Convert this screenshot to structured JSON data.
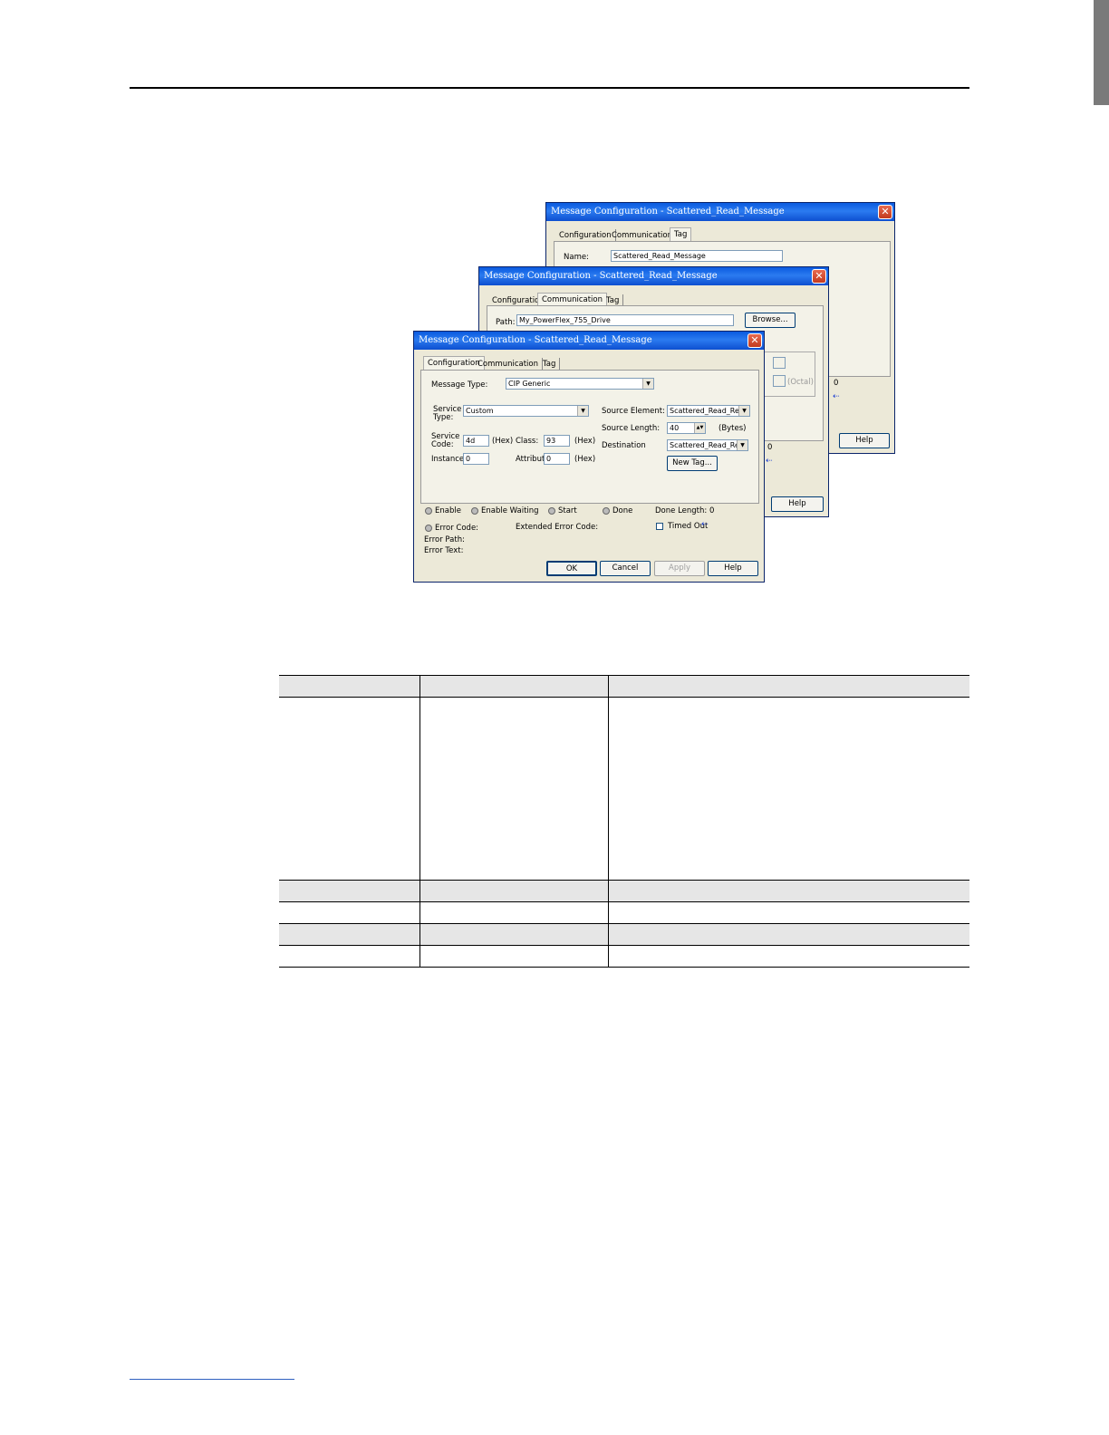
{
  "dialogs": {
    "back": {
      "title": "Message Configuration - Scattered_Read_Message",
      "tabs": [
        "Configuration",
        "Communication",
        "Tag"
      ],
      "name_label": "Name:",
      "name_value": "Scattered_Read_Message",
      "peek_value": "0",
      "help_label": "Help"
    },
    "middle": {
      "title": "Message Configuration - Scattered_Read_Message",
      "tabs": [
        "Configuration",
        "Communication",
        "Tag"
      ],
      "path_label": "Path:",
      "path_value": "My_PowerFlex_755_Drive",
      "browse_label": "Browse...",
      "octal_label": "(Octal)",
      "peek_value": "0",
      "help_label": "Help"
    },
    "front": {
      "title": "Message Configuration - Scattered_Read_Message",
      "tabs": [
        "Configuration",
        "Communication",
        "Tag"
      ],
      "message_type_label": "Message Type:",
      "message_type_value": "CIP Generic",
      "service_type_label_1": "Service",
      "service_type_label_2": "Type:",
      "service_type_value": "Custom",
      "service_code_label_1": "Service",
      "service_code_label_2": "Code:",
      "service_code_value": "4d",
      "hex_label": "(Hex)",
      "class_label": "Class:",
      "class_value": "93",
      "instance_label": "Instance:",
      "instance_value": "0",
      "attribute_label": "Attribute:",
      "attribute_value": "0",
      "source_element_label": "Source Element:",
      "source_element_value": "Scattered_Read_Req",
      "source_length_label": "Source Length:",
      "source_length_value": "40",
      "bytes_label": "(Bytes)",
      "destination_label": "Destination",
      "destination_value": "Scattered_Read_Re",
      "new_tag_label": "New Tag...",
      "status": {
        "enable": "Enable",
        "enable_waiting": "Enable Waiting",
        "start": "Start",
        "done": "Done",
        "done_length": "Done Length: 0",
        "error_code": "Error Code:",
        "extended_error_code": "Extended Error Code:",
        "timed_out": "Timed Out",
        "error_path": "Error Path:",
        "error_text": "Error Text:"
      },
      "buttons": {
        "ok": "OK",
        "cancel": "Cancel",
        "apply": "Apply",
        "help": "Help"
      }
    }
  }
}
